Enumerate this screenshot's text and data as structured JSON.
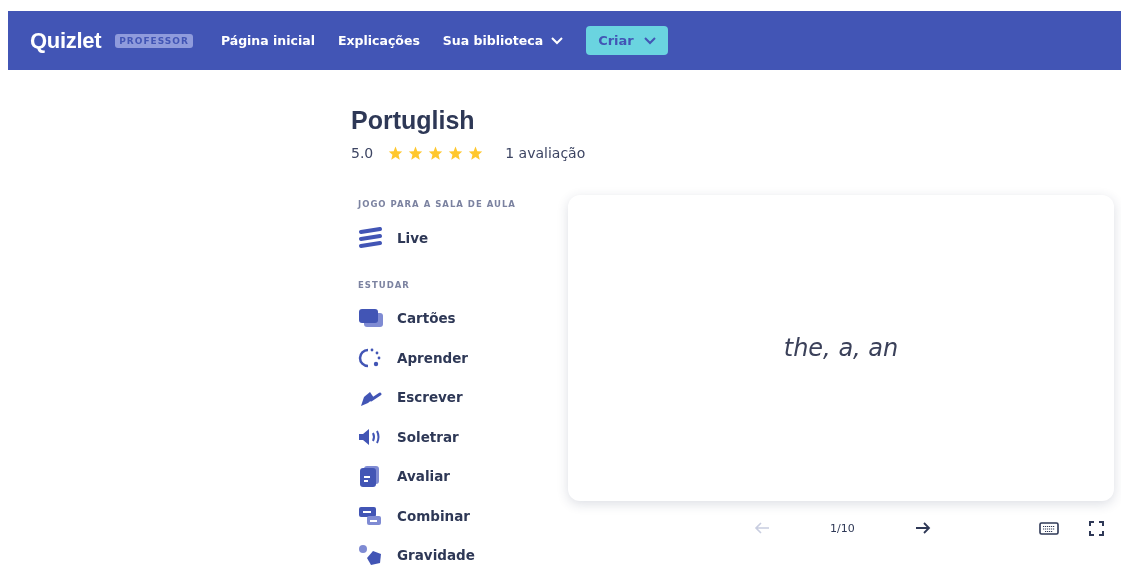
{
  "navbar": {
    "logo": "Quizlet",
    "badge": "PROFESSOR",
    "links": [
      {
        "label": "Página inicial",
        "has_caret": false
      },
      {
        "label": "Explicações",
        "has_caret": false
      },
      {
        "label": "Sua biblioteca",
        "has_caret": true
      }
    ],
    "create_button": "Criar"
  },
  "set": {
    "title": "Portuglish",
    "rating": "5.0",
    "stars": 5,
    "reviews": "1 avaliação"
  },
  "sections": [
    {
      "heading": "JOGO PARA A SALA DE AULA",
      "items": [
        "Live"
      ]
    },
    {
      "heading": "ESTUDAR",
      "items": [
        "Cartões",
        "Aprender",
        "Escrever",
        "Soletrar",
        "Avaliar",
        "Combinar",
        "Gravidade"
      ]
    }
  ],
  "flashcard": {
    "term": "the, a, an"
  },
  "controls": {
    "prev_disabled": true,
    "next_disabled": false,
    "counter": "1/10"
  }
}
